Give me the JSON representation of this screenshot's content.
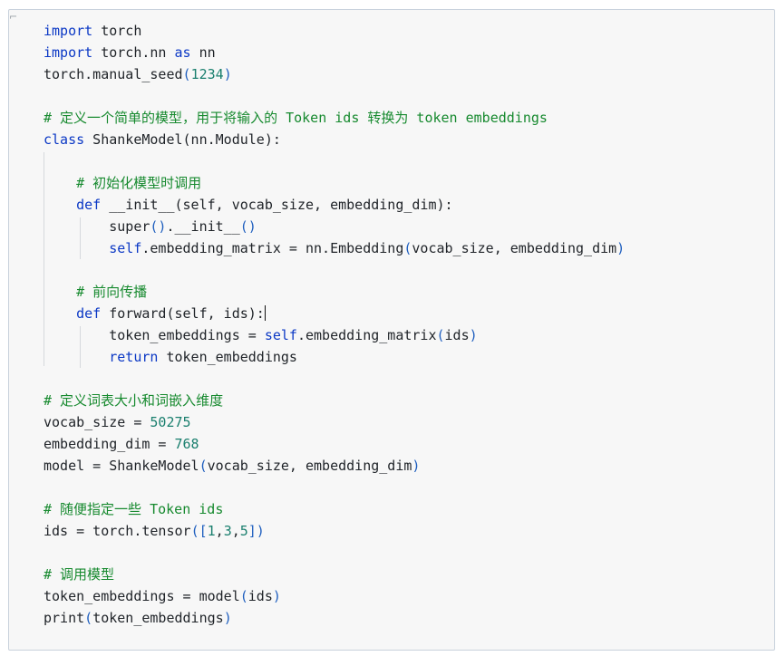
{
  "editor": {
    "lines": [
      {
        "tokens": [
          {
            "t": "import",
            "c": "kw"
          },
          {
            "t": " torch",
            "c": ""
          }
        ]
      },
      {
        "tokens": [
          {
            "t": "import",
            "c": "kw"
          },
          {
            "t": " torch.nn ",
            "c": ""
          },
          {
            "t": "as",
            "c": "kw"
          },
          {
            "t": " nn",
            "c": ""
          }
        ]
      },
      {
        "tokens": [
          {
            "t": "torch.manual_seed",
            "c": ""
          },
          {
            "t": "(",
            "c": "br"
          },
          {
            "t": "1234",
            "c": "num"
          },
          {
            "t": ")",
            "c": "br"
          }
        ]
      },
      {
        "tokens": []
      },
      {
        "tokens": [
          {
            "t": "# 定义一个简单的模型，用于将输入的 Token ids 转换为 token embeddings",
            "c": "cm"
          }
        ]
      },
      {
        "tokens": [
          {
            "t": "class",
            "c": "kw"
          },
          {
            "t": " ShankeModel(nn.Module):",
            "c": ""
          }
        ]
      },
      {
        "tokens": []
      },
      {
        "tokens": [
          {
            "t": "    ",
            "c": ""
          },
          {
            "t": "# 初始化模型时调用",
            "c": "cm"
          }
        ]
      },
      {
        "tokens": [
          {
            "t": "    ",
            "c": ""
          },
          {
            "t": "def",
            "c": "kw"
          },
          {
            "t": " __init__(self, vocab_size, embedding_dim):",
            "c": ""
          }
        ]
      },
      {
        "tokens": [
          {
            "t": "        super",
            "c": ""
          },
          {
            "t": "()",
            "c": "br"
          },
          {
            "t": ".__init__",
            "c": ""
          },
          {
            "t": "()",
            "c": "br"
          }
        ]
      },
      {
        "tokens": [
          {
            "t": "        ",
            "c": ""
          },
          {
            "t": "self",
            "c": "slf"
          },
          {
            "t": ".embedding_matrix = nn.Embedding",
            "c": ""
          },
          {
            "t": "(",
            "c": "br"
          },
          {
            "t": "vocab_size, embedding_dim",
            "c": ""
          },
          {
            "t": ")",
            "c": "br"
          }
        ]
      },
      {
        "tokens": []
      },
      {
        "tokens": [
          {
            "t": "    ",
            "c": ""
          },
          {
            "t": "# 前向传播",
            "c": "cm"
          }
        ]
      },
      {
        "tokens": [
          {
            "t": "    ",
            "c": ""
          },
          {
            "t": "def",
            "c": "kw"
          },
          {
            "t": " forward(self, ids):",
            "c": ""
          }
        ],
        "cursor_after": true
      },
      {
        "tokens": [
          {
            "t": "        token_embeddings = ",
            "c": ""
          },
          {
            "t": "self",
            "c": "slf"
          },
          {
            "t": ".embedding_matrix",
            "c": ""
          },
          {
            "t": "(",
            "c": "br"
          },
          {
            "t": "ids",
            "c": ""
          },
          {
            "t": ")",
            "c": "br"
          }
        ]
      },
      {
        "tokens": [
          {
            "t": "        ",
            "c": ""
          },
          {
            "t": "return",
            "c": "kw"
          },
          {
            "t": " token_embeddings",
            "c": ""
          }
        ]
      },
      {
        "tokens": []
      },
      {
        "tokens": [
          {
            "t": "# 定义词表大小和词嵌入维度",
            "c": "cm"
          }
        ]
      },
      {
        "tokens": [
          {
            "t": "vocab_size = ",
            "c": ""
          },
          {
            "t": "50275",
            "c": "num"
          }
        ]
      },
      {
        "tokens": [
          {
            "t": "embedding_dim = ",
            "c": ""
          },
          {
            "t": "768",
            "c": "num"
          }
        ]
      },
      {
        "tokens": [
          {
            "t": "model = ShankeModel",
            "c": ""
          },
          {
            "t": "(",
            "c": "br"
          },
          {
            "t": "vocab_size, embedding_dim",
            "c": ""
          },
          {
            "t": ")",
            "c": "br"
          }
        ]
      },
      {
        "tokens": []
      },
      {
        "tokens": [
          {
            "t": "# 随便指定一些 Token ids",
            "c": "cm"
          }
        ]
      },
      {
        "tokens": [
          {
            "t": "ids = torch.tensor",
            "c": ""
          },
          {
            "t": "([",
            "c": "br"
          },
          {
            "t": "1",
            "c": "num"
          },
          {
            "t": ",",
            "c": ""
          },
          {
            "t": "3",
            "c": "num"
          },
          {
            "t": ",",
            "c": ""
          },
          {
            "t": "5",
            "c": "num"
          },
          {
            "t": "])",
            "c": "br"
          }
        ]
      },
      {
        "tokens": []
      },
      {
        "tokens": [
          {
            "t": "# 调用模型",
            "c": "cm"
          }
        ]
      },
      {
        "tokens": [
          {
            "t": "token_embeddings = model",
            "c": ""
          },
          {
            "t": "(",
            "c": "br"
          },
          {
            "t": "ids",
            "c": ""
          },
          {
            "t": ")",
            "c": "br"
          }
        ]
      },
      {
        "tokens": [
          {
            "t": "print",
            "c": ""
          },
          {
            "t": "(",
            "c": "br"
          },
          {
            "t": "token_embeddings",
            "c": ""
          },
          {
            "t": ")",
            "c": "br"
          }
        ]
      }
    ]
  }
}
